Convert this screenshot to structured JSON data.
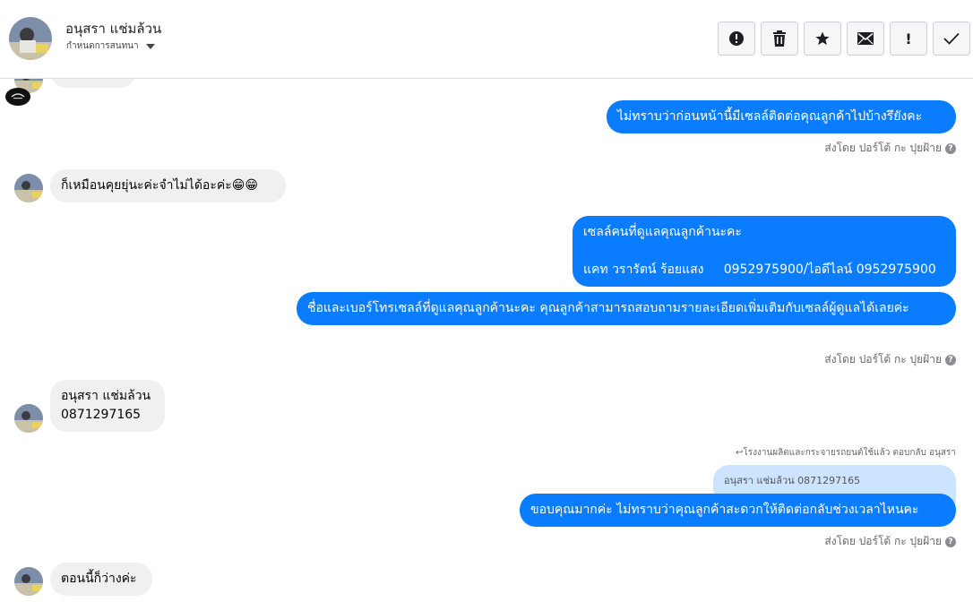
{
  "header": {
    "contact_name": "อนุสรา แช่มล้วน",
    "subline": "กำหนดการสนทนา",
    "toolbar": [
      {
        "icon": "alert-circle-icon"
      },
      {
        "icon": "trash-icon"
      },
      {
        "icon": "star-icon"
      },
      {
        "icon": "mail-icon"
      },
      {
        "icon": "exclamation-icon",
        "label": "!"
      },
      {
        "icon": "check-icon"
      }
    ]
  },
  "messages": {
    "m1": "ไม่ทราบว่าก่อนหน้านี้มีเซลล์ติดต่อคุณลูกค้าไปบ้างรึยังคะ",
    "m1_sentby": "ส่งโดย ปอร์โต้ กะ ปุยฝ้าย",
    "m2": "ก็เหมือนคุยยุ่นะค่ะจำไม่ได้อะค่ะ😁😁",
    "m3": "เซลล์คนที่ดูแลคุณลูกค้านะคะ\n\nแคท วรารัตน์ ร้อยแสง     0952975900/ไอดีไลน์ 0952975900",
    "m4": "ชื่อและเบอร์โทรเซลล์ที่ดูแลคุณลูกค้านะคะ คุณลูกค้าสามารถสอบถามรายละเอียดเพิ่มเติมกับเซลล์ผู้ดูแลได้เลยค่ะ",
    "m4_sentby": "ส่งโดย ปอร์โต้ กะ ปุยฝ้าย",
    "m5": "อนุสรา แช่มล้วน\n0871297165",
    "reply_note": "↩︎โรงงานผลิตและกระจายรถยนต์ใช้แล้ว ตอบกลับ อนุสรา",
    "quoted": "อนุสรา แช่มล้วน 0871297165",
    "m6": "ขอบคุณมากค่ะ ไม่ทราบว่าคุณลูกค้าสะดวกให้ติดต่อกลับช่วงเวลาไหนคะ",
    "m6_sentby": "ส่งโดย ปอร์โต้ กะ ปุยฝ้าย",
    "m7": "ตอนนี้ก็ว่างค่ะ",
    "help_mark": "?"
  },
  "colors": {
    "outgoing_bubble": "#0a7cff",
    "incoming_bubble": "#f0f0f0",
    "quoted_bubble": "#cce4ff"
  }
}
